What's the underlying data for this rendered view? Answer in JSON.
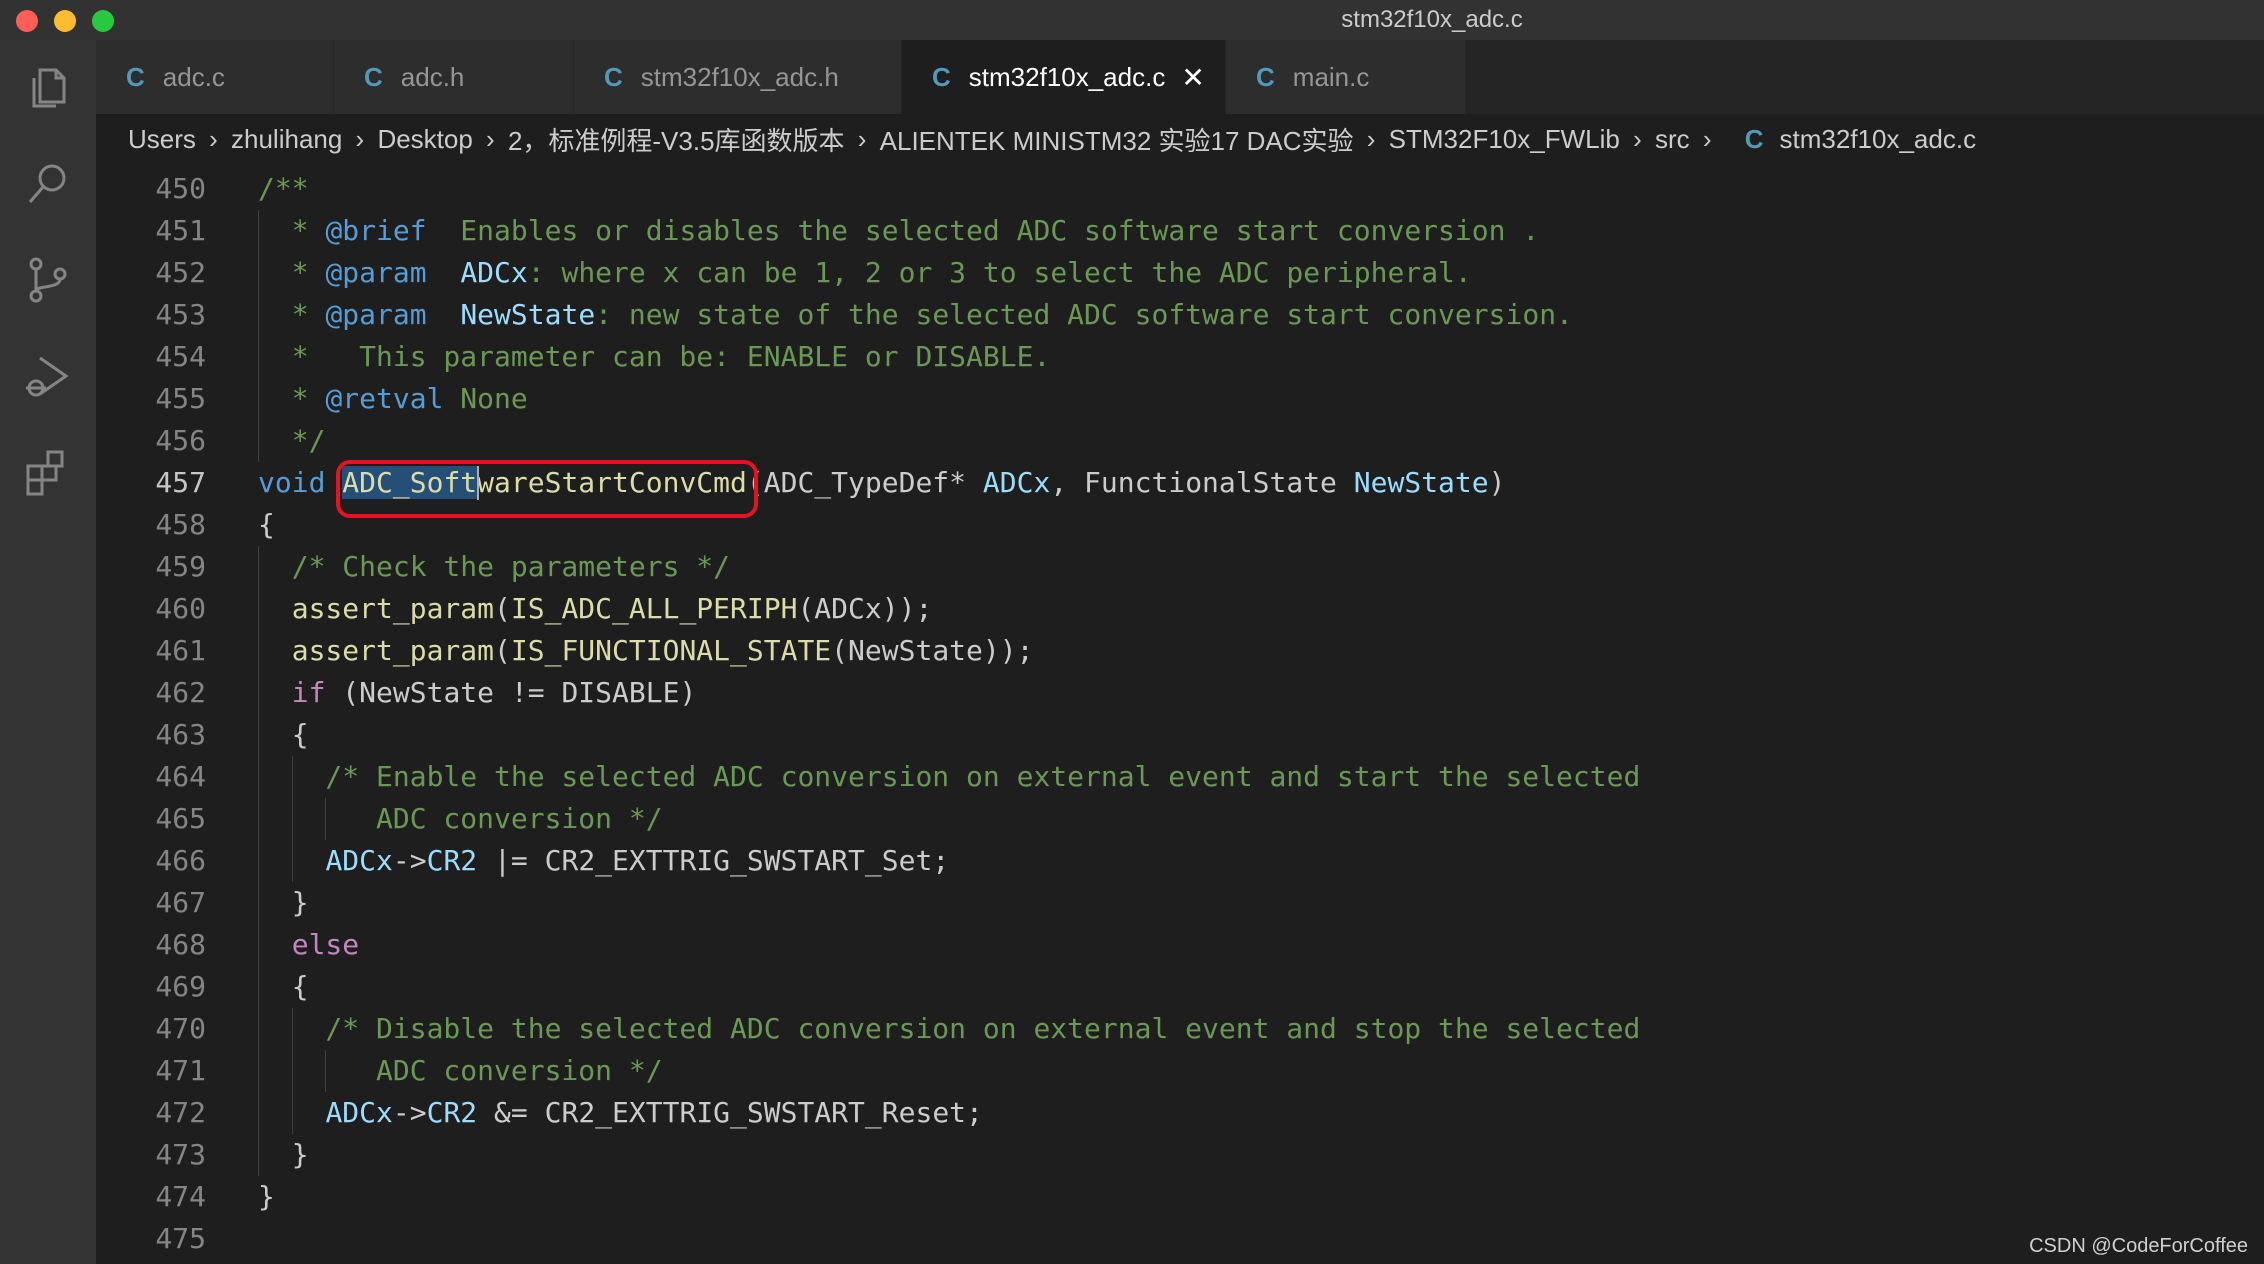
{
  "window": {
    "title": "stm32f10x_adc.c"
  },
  "activity_bar": [
    {
      "name": "explorer-icon"
    },
    {
      "name": "search-icon"
    },
    {
      "name": "source-control-icon"
    },
    {
      "name": "run-debug-icon"
    },
    {
      "name": "extensions-icon"
    }
  ],
  "tabs": [
    {
      "label": "adc.c",
      "icon": "C",
      "active": false
    },
    {
      "label": "adc.h",
      "icon": "C",
      "active": false
    },
    {
      "label": "stm32f10x_adc.h",
      "icon": "C",
      "active": false
    },
    {
      "label": "stm32f10x_adc.c",
      "icon": "C",
      "active": true
    },
    {
      "label": "main.c",
      "icon": "C",
      "active": false
    }
  ],
  "breadcrumb": [
    "Users",
    "zhulihang",
    "Desktop",
    "2，标准例程-V3.5库函数版本",
    "ALIENTEK MINISTM32 实验17 DAC实验",
    "STM32F10x_FWLib",
    "src"
  ],
  "breadcrumb_file": {
    "icon": "C",
    "label": "stm32f10x_adc.c"
  },
  "editor": {
    "current_line": 457,
    "lines": [
      {
        "n": "450",
        "t": "/**"
      },
      {
        "n": "451",
        "t": "  * @brief  Enables or disables the selected ADC software start conversion ."
      },
      {
        "n": "452",
        "t": "  * @param  ADCx: where x can be 1, 2 or 3 to select the ADC peripheral."
      },
      {
        "n": "453",
        "t": "  * @param  NewState: new state of the selected ADC software start conversion."
      },
      {
        "n": "454",
        "t": "  *   This parameter can be: ENABLE or DISABLE."
      },
      {
        "n": "455",
        "t": "  * @retval None"
      },
      {
        "n": "456",
        "t": "  */"
      },
      {
        "n": "457",
        "t": "void ADC_SoftwareStartConvCmd(ADC_TypeDef* ADCx, FunctionalState NewState)"
      },
      {
        "n": "458",
        "t": "{"
      },
      {
        "n": "459",
        "t": "  /* Check the parameters */"
      },
      {
        "n": "460",
        "t": "  assert_param(IS_ADC_ALL_PERIPH(ADCx));"
      },
      {
        "n": "461",
        "t": "  assert_param(IS_FUNCTIONAL_STATE(NewState));"
      },
      {
        "n": "462",
        "t": "  if (NewState != DISABLE)"
      },
      {
        "n": "463",
        "t": "  {"
      },
      {
        "n": "464",
        "t": "    /* Enable the selected ADC conversion on external event and start the selected"
      },
      {
        "n": "465",
        "t": "       ADC conversion */"
      },
      {
        "n": "466",
        "t": "    ADCx->CR2 |= CR2_EXTTRIG_SWSTART_Set;"
      },
      {
        "n": "467",
        "t": "  }"
      },
      {
        "n": "468",
        "t": "  else"
      },
      {
        "n": "469",
        "t": "  {"
      },
      {
        "n": "470",
        "t": "    /* Disable the selected ADC conversion on external event and stop the selected"
      },
      {
        "n": "471",
        "t": "       ADC conversion */"
      },
      {
        "n": "472",
        "t": "    ADCx->CR2 &= CR2_EXTTRIG_SWSTART_Reset;"
      },
      {
        "n": "473",
        "t": "  }"
      },
      {
        "n": "474",
        "t": "}"
      },
      {
        "n": "475",
        "t": ""
      }
    ]
  },
  "watermark": "CSDN @CodeForCoffee",
  "colors": {
    "comment": "#6a9955",
    "keyword": "#569cd6",
    "param": "#9cdcfe",
    "function": "#dcdcaa",
    "control": "#c586c0",
    "highlight_box": "#e81123",
    "selection": "#264f78"
  }
}
